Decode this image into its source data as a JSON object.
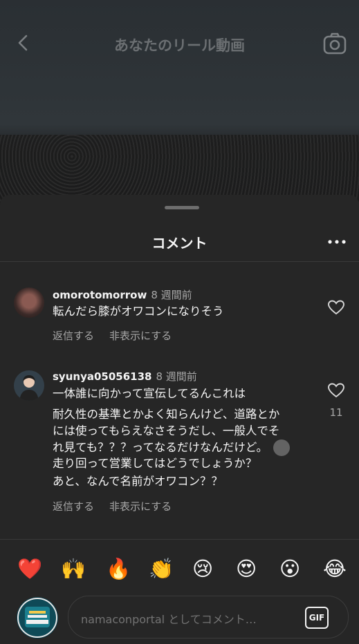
{
  "header": {
    "title": "あなたのリール動画",
    "back_icon": "chevron-left-icon",
    "camera_icon": "camera-icon"
  },
  "sheet": {
    "title": "コメント",
    "more_icon": "more-horizontal-icon"
  },
  "comments": [
    {
      "username": "omorotomorrow",
      "time": "8 週間前",
      "lines": [
        "転んだら膝がオワコンになりそう"
      ],
      "reply_label": "返信する",
      "hide_label": "非表示にする",
      "likes": ""
    },
    {
      "username": "syunya05056138",
      "time": "8 週間前",
      "lines": [
        "一体誰に向かって宣伝してるんこれは",
        "耐久性の基準とかよく知らんけど、道路とか",
        "には使ってもらえなさそうだし、一般人でそ",
        "れ見ても？？？ってなるだけなんだけど。",
        "走り回って営業してはどうでしょうか？",
        "あと、なんで名前がオワコン？？"
      ],
      "reply_label": "返信する",
      "hide_label": "非表示にする",
      "likes": "11"
    }
  ],
  "emoji_bar": [
    "❤️",
    "🙌",
    "🔥",
    "👏",
    "😢",
    "😍",
    "😮",
    "😂"
  ],
  "compose": {
    "placeholder": "namaconportal としてコメント…",
    "gif_label": "GIF",
    "avatar_logo_text": "#shorts NAMACON PORTAL"
  },
  "colors": {
    "sheet_bg": "#262626",
    "secondary_text": "#a8a8a8",
    "primary_text": "#f5f5f5"
  }
}
